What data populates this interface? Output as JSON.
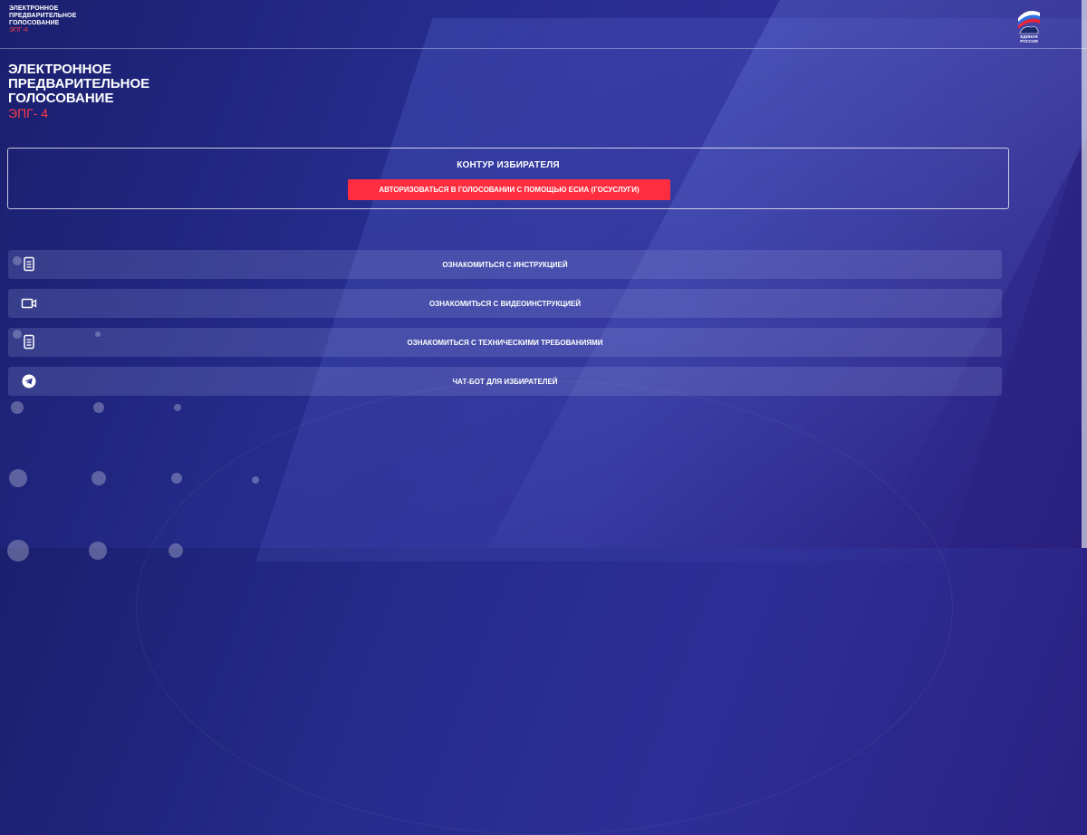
{
  "header": {
    "brand_line1": "ЭЛЕКТРОННОЕ",
    "brand_line2": "ПРЕДВАРИТЕЛЬНОЕ",
    "brand_line3": "ГОЛОСОВАНИЕ",
    "brand_sub": "ЭПГ-4",
    "logo_text": "ЕДИНАЯ РОССИЯ"
  },
  "hero": {
    "line1": "ЭЛЕКТРОННОЕ",
    "line2": "ПРЕДВАРИТЕЛЬНОЕ",
    "line3": "ГОЛОСОВАНИЕ",
    "sub": "ЭПГ- 4"
  },
  "voter": {
    "title": "КОНТУР ИЗБИРАТЕЛЯ",
    "auth_button": "АВТОРИЗОВАТЬСЯ В ГОЛОСОВАНИИ С ПОМОЩЬЮ ЕСИА (ГОСУСЛУГИ)"
  },
  "menu": [
    {
      "label": "ОЗНАКОМИТЬСЯ С ИНСТРУКЦИЕЙ",
      "icon": "document-icon"
    },
    {
      "label": "ОЗНАКОМИТЬСЯ С ВИДЕОИНСТРУКЦИЕЙ",
      "icon": "video-icon"
    },
    {
      "label": "ОЗНАКОМИТЬСЯ С ТЕХНИЧЕСКИМИ ТРЕБОВАНИЯМИ",
      "icon": "document-icon"
    },
    {
      "label": "ЧАТ-БОТ ДЛЯ ИЗБИРАТЕЛЕЙ",
      "icon": "telegram-icon"
    }
  ],
  "colors": {
    "accent": "#ff2d3f",
    "background": "#252c8c"
  }
}
